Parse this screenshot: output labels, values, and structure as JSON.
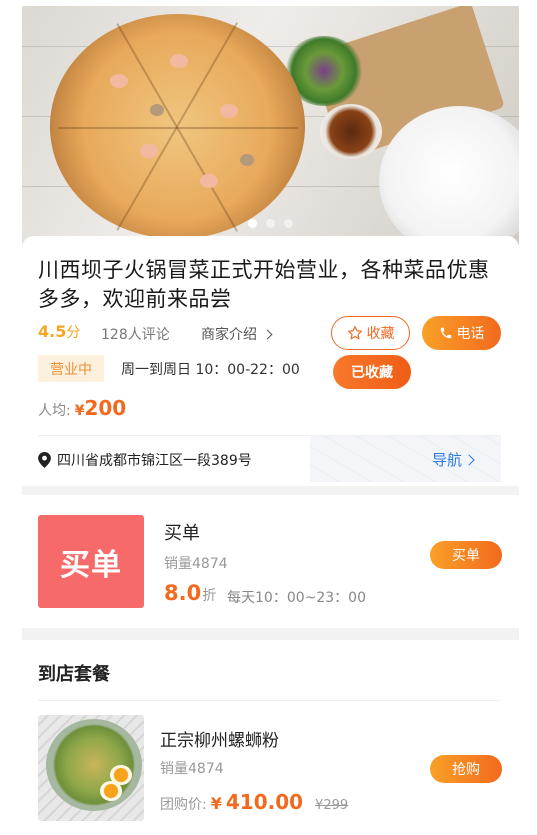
{
  "banner": {
    "carousel_dots": 3,
    "active_dot": 0
  },
  "shop": {
    "title": "川西坝子火锅冒菜正式开始营业，各种菜品优惠多多，欢迎前来品尝",
    "rating_value": "4.5",
    "rating_unit": "分",
    "reviews": "128人评论",
    "merchant_intro": "商家介绍",
    "favorite_label": "收藏",
    "call_label": "电话",
    "saved_label": "已收藏",
    "status": "营业中",
    "hours": "周一到周日 10：00-22：00",
    "avg_label": "人均:",
    "avg_currency": "¥",
    "avg_price": "200",
    "address": "四川省成都市锦江区一段389号",
    "nav_label": "导航"
  },
  "pay": {
    "tile_text": "买单",
    "name": "买单",
    "sales": "销量4874",
    "discount_value": "8.0",
    "discount_unit": "折",
    "hours": "每天10：00~23：00",
    "button": "买单"
  },
  "packages": {
    "section_title": "到店套餐",
    "items": [
      {
        "name": "正宗柳州螺蛳粉",
        "sales": "销量4874",
        "price_label": "团购价:",
        "currency": "¥",
        "price": "410.00",
        "original_price": "¥299",
        "button": "抢购"
      }
    ]
  },
  "colors": {
    "accent": "#f26a1e",
    "accent_light": "#f9a027",
    "rating": "#f5a623",
    "status_bg": "#fdf0dc",
    "pay_tile": "#f76a6a",
    "nav": "#2a7ae2"
  }
}
